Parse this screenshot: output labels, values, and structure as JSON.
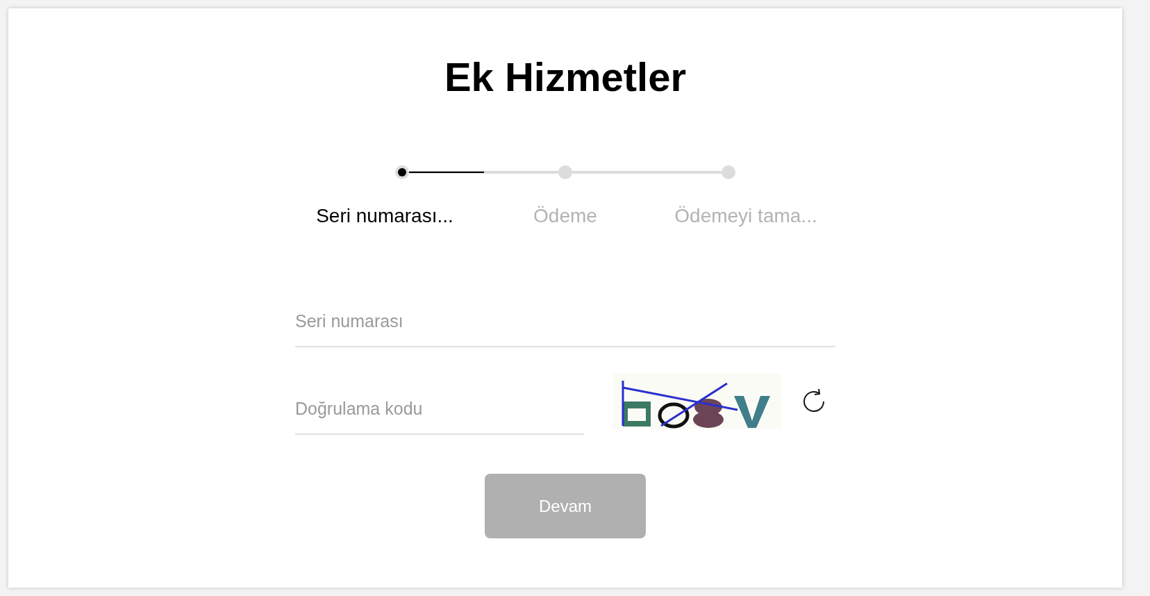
{
  "title": "Ek Hizmetler",
  "stepper": {
    "segments": [
      {
        "level": 0.5
      }
    ],
    "steps": [
      {
        "label": "Seri numarası...",
        "selected": true
      },
      {
        "label": "Ödeme",
        "selected": false
      },
      {
        "label": "Ödemeyi tama...",
        "selected": false
      }
    ]
  },
  "fields": [
    {
      "placeholder": "Seri numarası"
    },
    {
      "placeholder": "Doğrulama kodu"
    }
  ],
  "button": {
    "label": "Devam",
    "disabled": true
  }
}
